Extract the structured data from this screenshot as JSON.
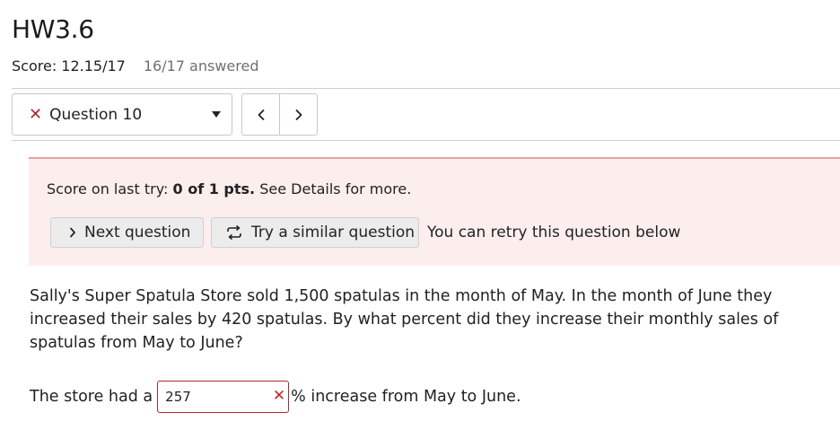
{
  "header": {
    "title": "HW3.6",
    "score": "Score: 12.15/17",
    "answered": "16/17 answered"
  },
  "navigation": {
    "question_status_icon": "x-icon",
    "question_label": "Question 10",
    "prev_icon": "chevron-left-icon",
    "next_icon": "chevron-right-icon"
  },
  "feedback": {
    "score_prefix": "Score on last try: ",
    "score_value": "0 of 1 pts.",
    "score_suffix": " See Details for more.",
    "next_button_label": "Next question",
    "similar_button_label": "Try a similar question",
    "retry_note": "You can retry this question below"
  },
  "question": {
    "text": "Sally's Super Spatula Store sold 1,500 spatulas in the month of May. In the month of June they increased their sales by 420 spatulas. By what percent did they increase their monthly sales of spatulas from May to June?",
    "answer_prefix": "The store had a",
    "answer_value": "257",
    "answer_suffix": "% increase from May to June."
  },
  "colors": {
    "error_red": "#b3262b",
    "feedback_bg": "#fdeeee",
    "feedback_border": "#e7a2a2",
    "button_bg": "#ececec"
  }
}
